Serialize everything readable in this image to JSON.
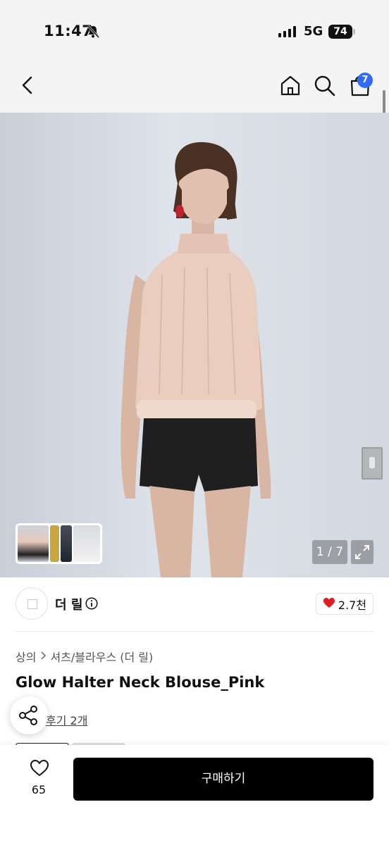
{
  "status_bar": {
    "time": "11:47",
    "network": "5G",
    "battery": "74"
  },
  "nav": {
    "cart_count": "7"
  },
  "gallery": {
    "counter": "1 / 7"
  },
  "brand": {
    "name": "더 릴",
    "likes": "2.7천"
  },
  "product": {
    "breadcrumb": [
      "상의",
      "셔츠/블라우스 (더 릴)"
    ],
    "title": "Glow Halter Neck Blouse_Pink",
    "reviews_label": "후기 2개"
  },
  "bottom_bar": {
    "wish_count": "65",
    "buy_label": "구매하기"
  },
  "colors": {
    "accent": "#2f6bff",
    "heart": "#e02020",
    "buy_button": "#000000"
  }
}
